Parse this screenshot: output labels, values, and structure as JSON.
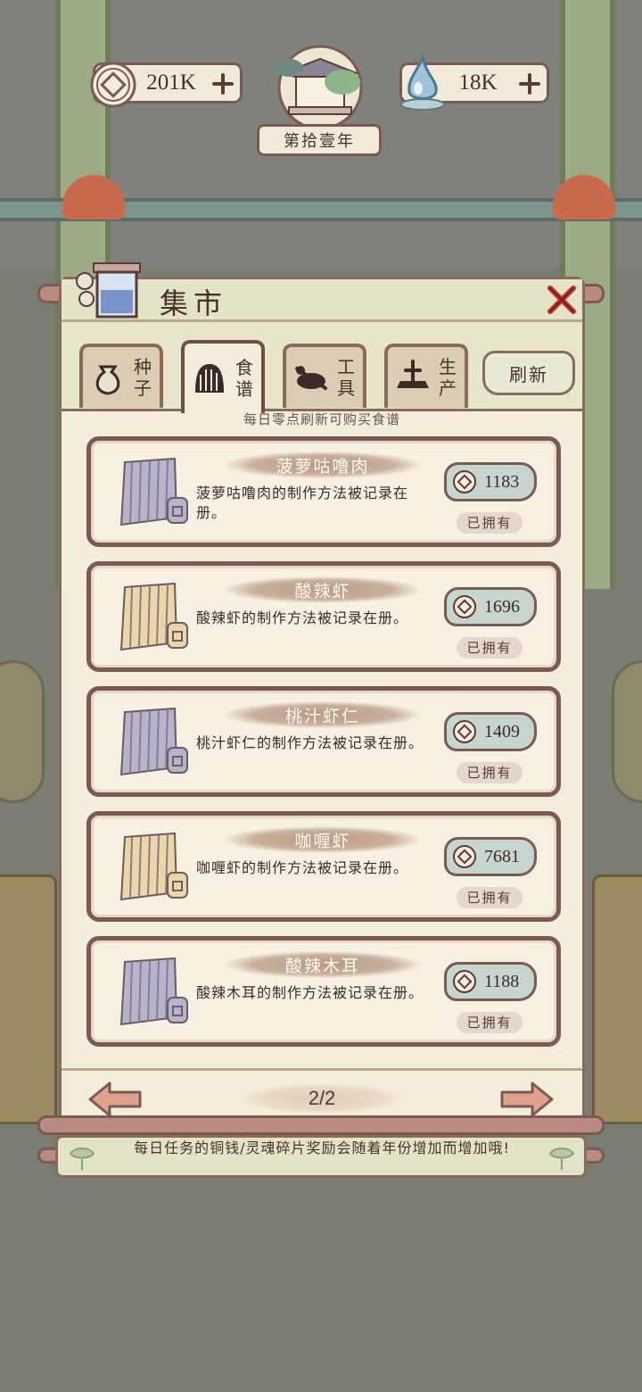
{
  "currencies": {
    "coin": {
      "icon": "copper-coin-icon",
      "value": "201K"
    },
    "soul": {
      "icon": "soul-flame-icon",
      "value": "18K"
    }
  },
  "year": {
    "label": "第拾壹年"
  },
  "panel": {
    "title": "集市",
    "tabs": [
      {
        "label": "种子",
        "icon": "seed-bag-icon",
        "active": false
      },
      {
        "label": "食谱",
        "icon": "recipe-scroll-icon",
        "active": true
      },
      {
        "label": "工具",
        "icon": "tool-icon",
        "active": false
      },
      {
        "label": "生产",
        "icon": "production-icon",
        "active": false
      }
    ],
    "refresh_label": "刷新",
    "notice": "每日零点刷新可购买食谱"
  },
  "recipes": [
    {
      "name": "菠萝咕噜肉",
      "desc": "菠萝咕噜肉的制作方法被记录在册。",
      "price": "1183",
      "status": "已拥有",
      "scroll": "purple"
    },
    {
      "name": "酸辣虾",
      "desc": "酸辣虾的制作方法被记录在册。",
      "price": "1696",
      "status": "已拥有",
      "scroll": "yellow"
    },
    {
      "name": "桃汁虾仁",
      "desc": "桃汁虾仁的制作方法被记录在册。",
      "price": "1409",
      "status": "已拥有",
      "scroll": "purple"
    },
    {
      "name": "咖喱虾",
      "desc": "咖喱虾的制作方法被记录在册。",
      "price": "7681",
      "status": "已拥有",
      "scroll": "yellow"
    },
    {
      "name": "酸辣木耳",
      "desc": "酸辣木耳的制作方法被记录在册。",
      "price": "1188",
      "status": "已拥有",
      "scroll": "purple"
    }
  ],
  "pager": {
    "label": "2/2",
    "current": 2,
    "total": 2
  },
  "tip": "每日任务的铜钱/灵魂碎片奖励会随着年份增加而增加哦!",
  "colors": {
    "panel_bg": "#f3eddb",
    "border": "#7c5a54",
    "price_pill": "#c6d6cf",
    "scroll_purple": "#b8b3cc",
    "scroll_yellow": "#ead6a6",
    "arrow": "#e0a08e"
  }
}
